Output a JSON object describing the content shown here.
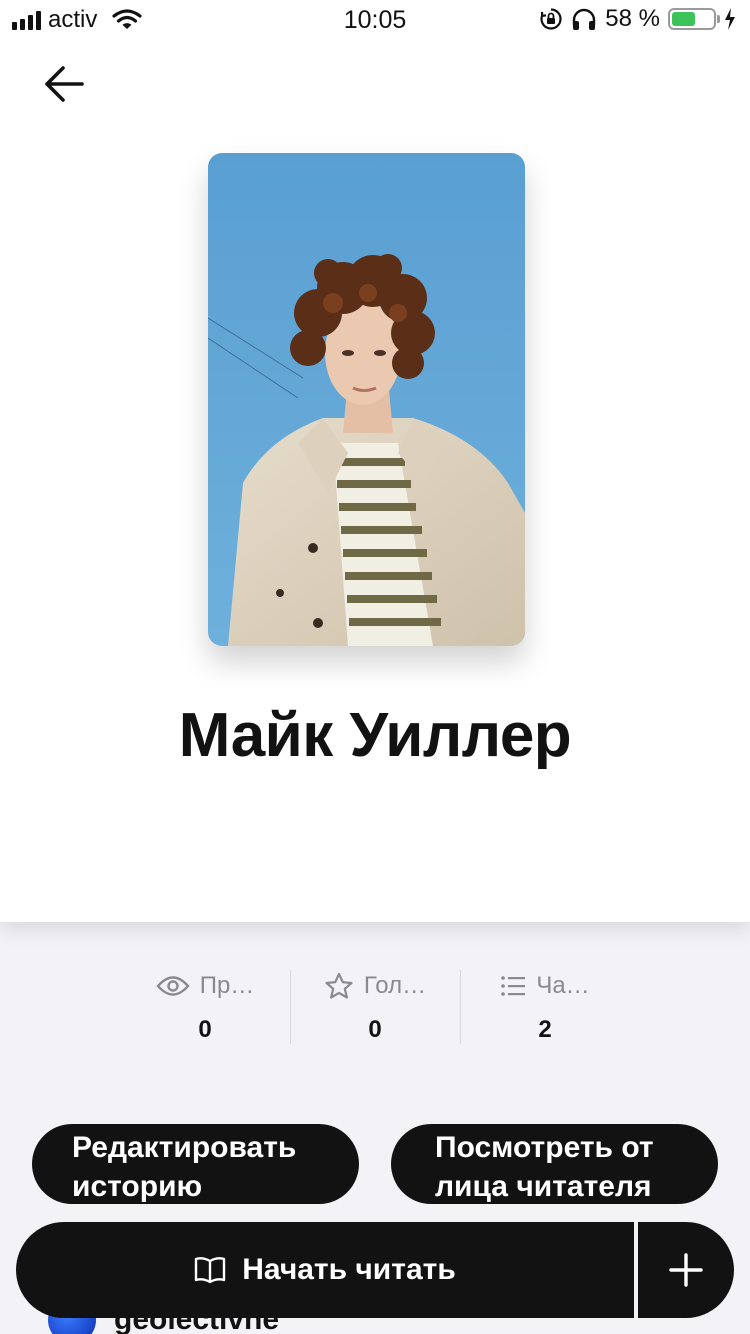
{
  "status_bar": {
    "carrier": "activ",
    "time": "10:05",
    "battery_percent": "58 %",
    "battery_level": 0.58,
    "icons": [
      "signal-icon",
      "wifi-icon",
      "orientation-lock-icon",
      "headphones-icon",
      "battery-icon",
      "charging-icon"
    ]
  },
  "nav": {
    "back_icon": "arrow-left-icon"
  },
  "story": {
    "title": "Майк Уиллер",
    "cover_description": "cover-photo"
  },
  "stats": [
    {
      "icon": "eye-icon",
      "label": "Пр…",
      "value": "0"
    },
    {
      "icon": "star-icon",
      "label": "Гол…",
      "value": "0"
    },
    {
      "icon": "list-icon",
      "label": "Ча…",
      "value": "2"
    }
  ],
  "actions": {
    "edit_story": "Редактировать историю",
    "preview_as_reader": "Посмотреть от лица читателя"
  },
  "author": {
    "name": "geolectivne"
  },
  "bottom_bar": {
    "read_label": "Начать читать",
    "read_icon": "book-icon",
    "add_icon": "plus-icon"
  },
  "colors": {
    "accent_dark": "#121212",
    "background": "#f3f2f7",
    "battery_green": "#3dc35a"
  }
}
